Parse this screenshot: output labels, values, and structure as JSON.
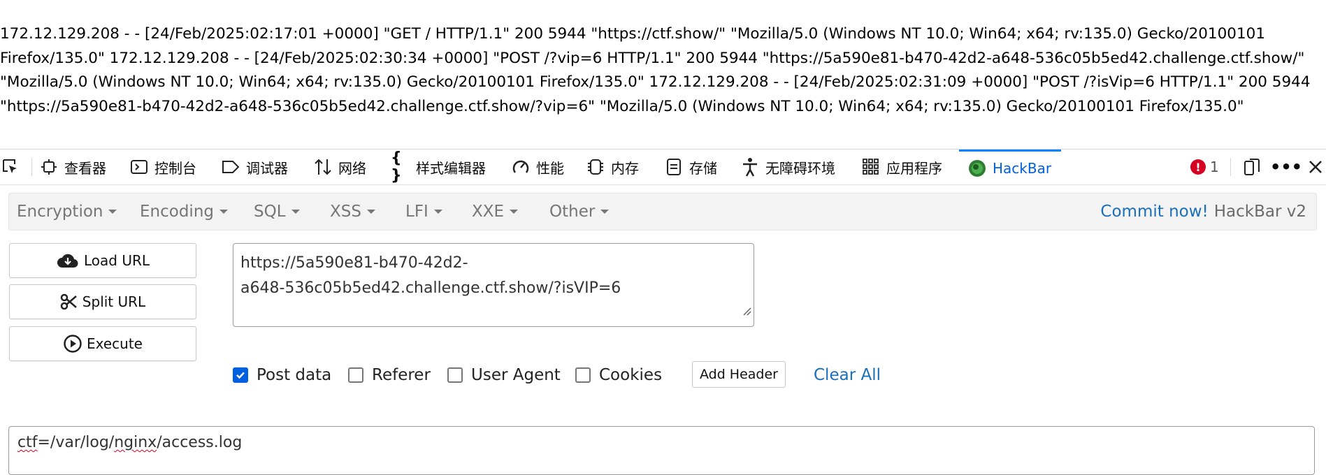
{
  "log_text": "172.12.129.208 - - [24/Feb/2025:02:17:01 +0000] \"GET / HTTP/1.1\" 200 5944 \"https://ctf.show/\" \"Mozilla/5.0 (Windows NT 10.0; Win64; x64; rv:135.0) Gecko/20100101 Firefox/135.0\" 172.12.129.208 - - [24/Feb/2025:02:30:34 +0000] \"POST /?vip=6 HTTP/1.1\" 200 5944 \"https://5a590e81-b470-42d2-a648-536c05b5ed42.challenge.ctf.show/\" \"Mozilla/5.0 (Windows NT 10.0; Win64; x64; rv:135.0) Gecko/20100101 Firefox/135.0\" 172.12.129.208 - - [24/Feb/2025:02:31:09 +0000] \"POST /?isVip=6 HTTP/1.1\" 200 5944 \"https://5a590e81-b470-42d2-a648-536c05b5ed42.challenge.ctf.show/?vip=6\" \"Mozilla/5.0 (Windows NT 10.0; Win64; x64; rv:135.0) Gecko/20100101 Firefox/135.0\"",
  "devtools": {
    "tabs": [
      {
        "label": "查看器",
        "icon": "inspector-icon"
      },
      {
        "label": "控制台",
        "icon": "console-icon"
      },
      {
        "label": "调试器",
        "icon": "debugger-icon"
      },
      {
        "label": "网络",
        "icon": "network-icon"
      },
      {
        "label": "样式编辑器",
        "icon": "style-editor-icon"
      },
      {
        "label": "性能",
        "icon": "performance-icon"
      },
      {
        "label": "内存",
        "icon": "memory-icon"
      },
      {
        "label": "存储",
        "icon": "storage-icon"
      },
      {
        "label": "无障碍环境",
        "icon": "accessibility-icon"
      },
      {
        "label": "应用程序",
        "icon": "application-icon"
      },
      {
        "label": "HackBar",
        "icon": "hackbar-icon"
      }
    ],
    "error_count": "1",
    "accent_color": "#0a84ff",
    "error_color": "#d70022"
  },
  "hackbar": {
    "menus": [
      "Encryption",
      "Encoding",
      "SQL",
      "XSS",
      "LFI",
      "XXE",
      "Other"
    ],
    "commit_link": "Commit now!",
    "version": "HackBar v2",
    "buttons": {
      "load": "Load URL",
      "split": "Split URL",
      "execute": "Execute"
    },
    "url_value": "https://5a590e81-b470-42d2-a648-536c05b5ed42.challenge.ctf.show/?isVIP=6",
    "url_line1": "https://5a590e81-b470-42d2-",
    "url_line2": "a648-536c05b5ed42.challenge.ctf.show/?isVIP=6",
    "options": {
      "post_data": "Post data",
      "referer": "Referer",
      "user_agent": "User Agent",
      "cookies": "Cookies"
    },
    "options_checked": {
      "post_data": true,
      "referer": false,
      "user_agent": false,
      "cookies": false
    },
    "add_header": "Add Header",
    "clear_all": "Clear All",
    "post_body_part1": "ctf",
    "post_body_part2": "=/var/log/",
    "post_body_part3": "nginx",
    "post_body_part4": "/access.log"
  }
}
